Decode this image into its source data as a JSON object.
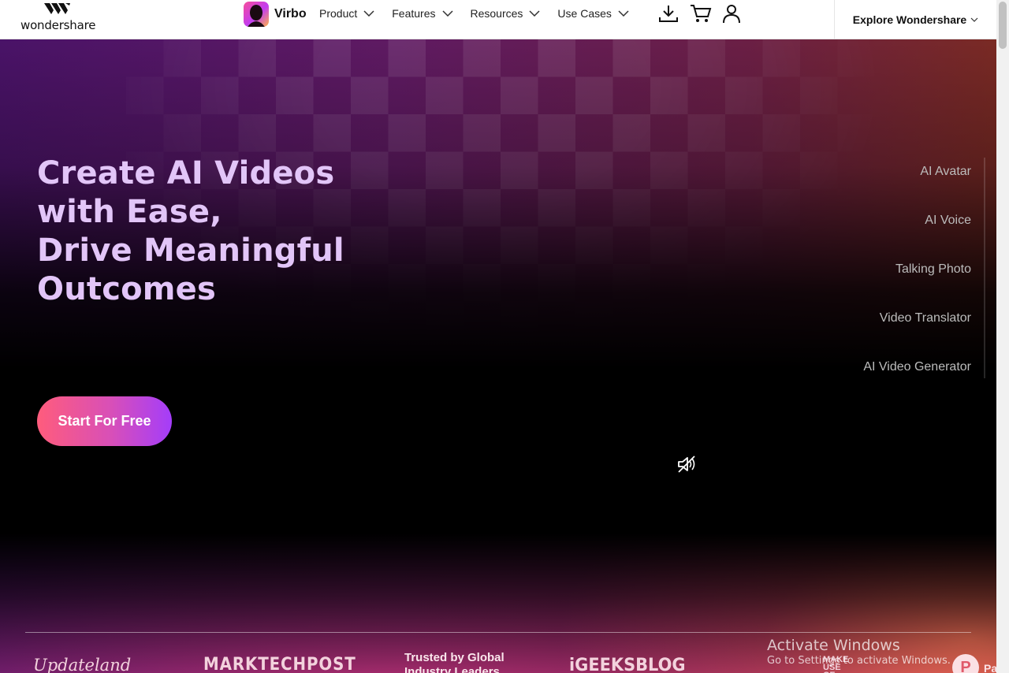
{
  "header": {
    "brand": "wondershare",
    "product_name": "Virbo",
    "nav": [
      {
        "label": "Product"
      },
      {
        "label": "Features"
      },
      {
        "label": "Resources"
      },
      {
        "label": "Use Cases"
      }
    ],
    "icons": [
      "download-icon",
      "cart-icon",
      "user-icon"
    ],
    "explore_label": "Explore Wondershare"
  },
  "hero": {
    "headline": [
      "Create AI Videos",
      "with Ease,",
      "Drive Meaningful",
      "Outcomes"
    ],
    "cta_label": "Start For Free",
    "side_menu": [
      {
        "label": "AI Avatar"
      },
      {
        "label": "AI Voice"
      },
      {
        "label": "Talking Photo"
      },
      {
        "label": "Video Translator"
      },
      {
        "label": "AI Video Generator"
      }
    ],
    "mute_icon": "speaker-muted-icon"
  },
  "trusted": {
    "logos": [
      "Updateland",
      "MARKTECHPOST",
      "Trusted by Global Industry Leaders",
      "iGEEKSBLOG",
      "MAKE USE OF",
      "P"
    ],
    "partial_text": "Pa"
  },
  "windows_watermark": {
    "title": "Activate Windows",
    "subtitle": "Go to Settings to activate Windows."
  },
  "colors": {
    "headline": "#e2c5f8",
    "cta_start": "#ff5c7c",
    "cta_end": "#a43dfa",
    "side_menu_text": "#bcbcbc"
  }
}
